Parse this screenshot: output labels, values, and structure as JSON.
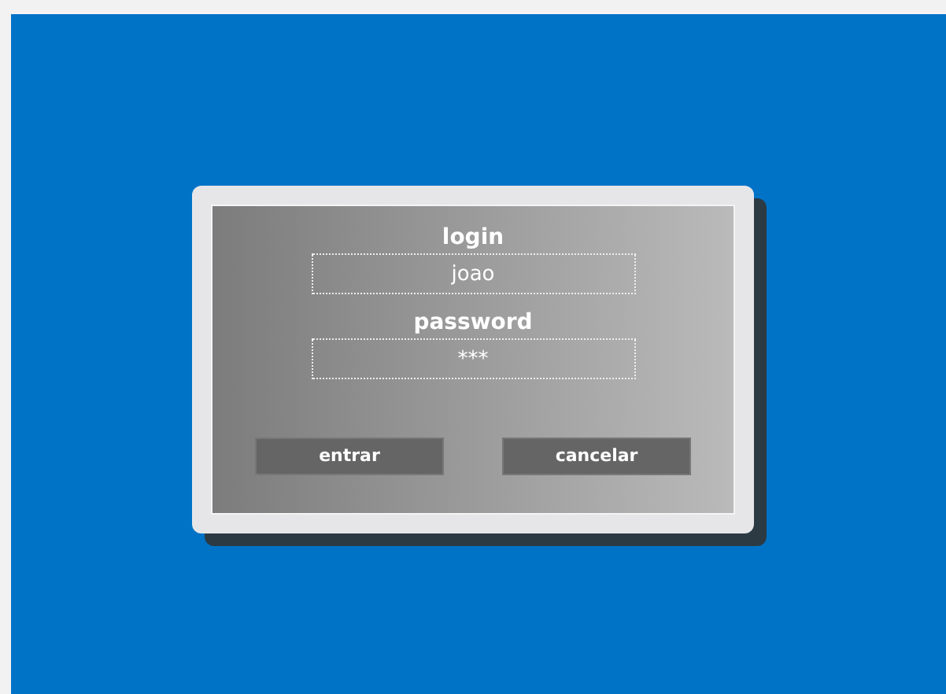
{
  "login": {
    "label": "login",
    "value": "joao"
  },
  "password": {
    "label": "password",
    "value": "***"
  },
  "buttons": [
    "entrar",
    "cancelar"
  ]
}
